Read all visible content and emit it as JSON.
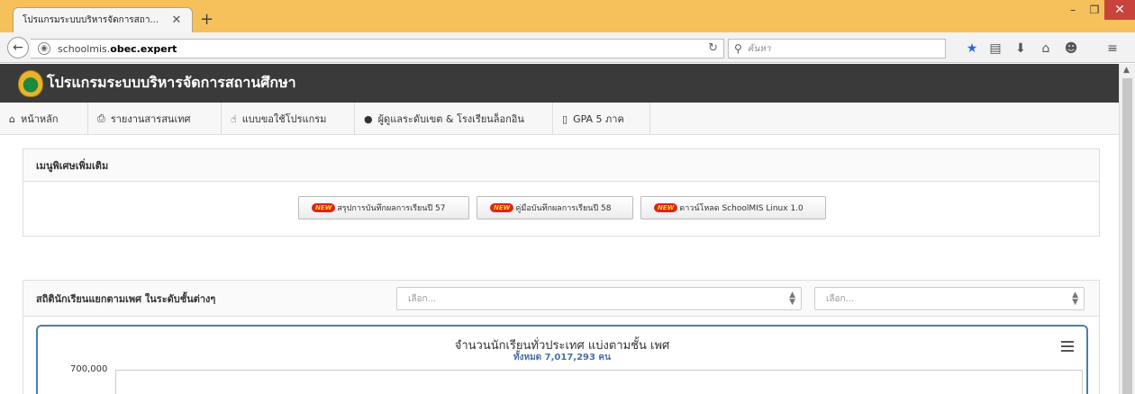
{
  "browser": {
    "tab_title": "โปรแกรมระบบบริหารจัดการสถา...",
    "url_prefix": "schoolmis.",
    "url_domain": "obec.expert",
    "search_placeholder": "ค้นหา"
  },
  "site": {
    "title": "โปรแกรมระบบบริหารจัดการสถานศึกษา"
  },
  "menu": [
    {
      "label": "หน้าหลัก",
      "icon": "home-icon"
    },
    {
      "label": "รายงานสารสนเทศ",
      "icon": "print-icon"
    },
    {
      "label": "แบบขอใช้โปรแกรม",
      "icon": "hand-pointer-icon"
    },
    {
      "label": "ผู้ดูแลระดับเขต & โรงเรียนล็อกอิน",
      "icon": "user-icon"
    },
    {
      "label": "GPA 5 ภาค",
      "icon": "file-icon"
    }
  ],
  "special_menu": {
    "heading": "เมนูพิเศษเพิ่มเติม",
    "badge": "NEW",
    "buttons": [
      "สรุปการบันทึกผลการเรียนปี 57",
      "คู่มือบันทึกผลการเรียนปี 58",
      "ดาวน์โหลด SchoolMIS Linux 1.0"
    ]
  },
  "stats": {
    "heading": "สถิตินักเรียนแยกตามเพศ ในระดับชั้นต่างๆ",
    "select1_placeholder": "เลือก...",
    "select2_placeholder": "เลือก..."
  },
  "chart": {
    "title": "จำนวนนักเรียนทั่วประเทศ แบ่งตามชั้น เพศ",
    "subtitle": "ทั้งหมด 7,017,293 คน",
    "y_tick_top": "700,000"
  }
}
